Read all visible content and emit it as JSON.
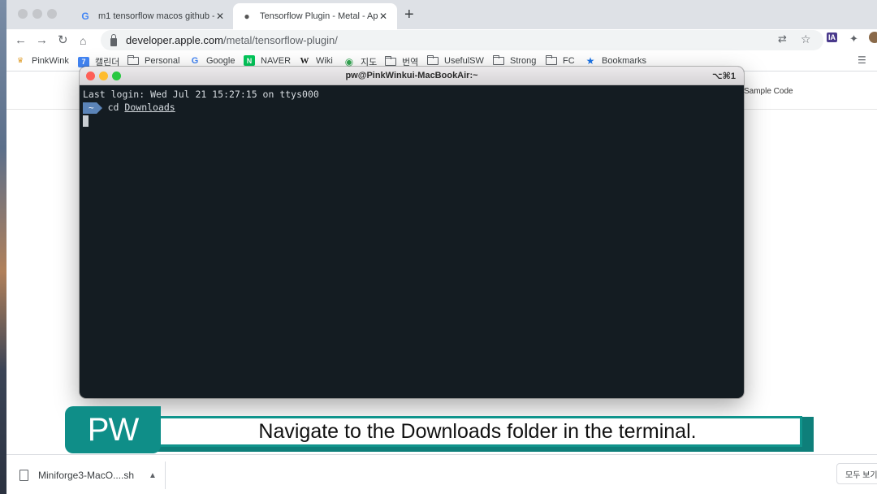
{
  "browser": {
    "tabs": [
      {
        "title": "m1 tensorflow macos github - (",
        "favicon": "google-g-icon",
        "active": false
      },
      {
        "title": "Tensorflow Plugin - Metal - App",
        "favicon": "apple-icon",
        "active": true
      }
    ],
    "newtab_symbol": "+",
    "omnibox": {
      "host": "developer.apple.com",
      "path": "/metal/tensorflow-plugin/"
    },
    "bookmarks": [
      {
        "label": "PinkWink",
        "icon": "crown-icon"
      },
      {
        "label": "캘린더",
        "icon": "calendar-icon",
        "icon_text": "7"
      },
      {
        "label": "Personal",
        "icon": "folder-icon"
      },
      {
        "label": "Google",
        "icon": "google-g-icon"
      },
      {
        "label": "NAVER",
        "icon": "naver-icon",
        "icon_text": "N"
      },
      {
        "label": "Wiki",
        "icon": "wikipedia-icon",
        "icon_text": "W"
      },
      {
        "label": "지도",
        "icon": "map-pin-icon"
      },
      {
        "label": "번역",
        "icon": "folder-icon"
      },
      {
        "label": "UsefulSW",
        "icon": "folder-icon"
      },
      {
        "label": "Strong",
        "icon": "folder-icon"
      },
      {
        "label": "FC",
        "icon": "folder-icon"
      },
      {
        "label": "Bookmarks",
        "icon": "star-icon"
      }
    ],
    "extension_badge": "IA"
  },
  "page": {
    "nav_link": "Sample Code"
  },
  "terminal": {
    "title": "pw@PinkWinkui-MacBookAir:~",
    "shortcut": "⌥⌘1",
    "last_login": "Last login: Wed Jul 21 15:27:15 on ttys000",
    "prompt": "~",
    "command": "cd",
    "argument": "Downloads"
  },
  "caption": {
    "tag": "PW",
    "text": "Navigate to the Downloads folder in the terminal."
  },
  "downloads": {
    "file": "Miniforge3-MacO....sh",
    "show_all": "모두 보기"
  },
  "colors": {
    "accent_teal": "#0f8e88",
    "terminal_bg": "#141c22",
    "prompt_blue": "#5b84b8"
  }
}
